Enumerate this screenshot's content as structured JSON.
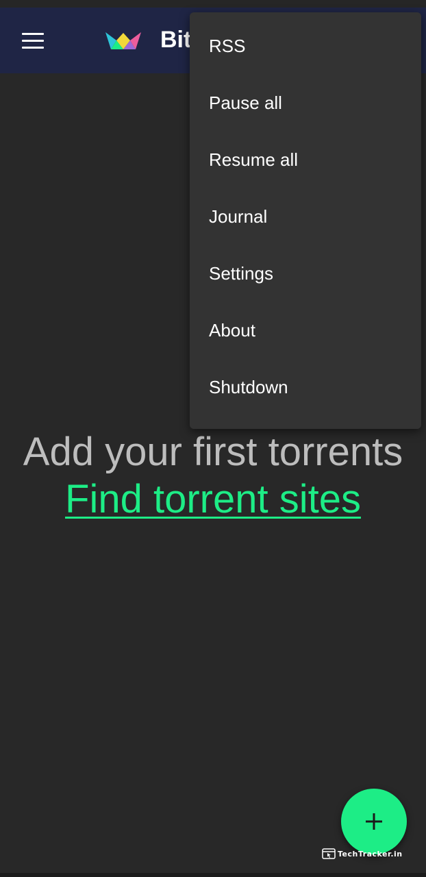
{
  "colors": {
    "background": "#282828",
    "app_bar": "#1f2545",
    "menu_background": "#333333",
    "accent": "#1ded86",
    "muted_text": "#bdbdbd",
    "text": "#ffffff"
  },
  "app_bar": {
    "menu_icon": "hamburger-menu-icon",
    "logo_icon": "crown-logo-icon",
    "title": "Bit"
  },
  "empty_state": {
    "title": "Add your first torrents",
    "link": "Find torrent sites"
  },
  "overflow_menu": {
    "items": [
      "RSS",
      "Pause all",
      "Resume all",
      "Journal",
      "Settings",
      "About",
      "Shutdown"
    ]
  },
  "fab": {
    "icon": "plus-icon"
  },
  "watermark": {
    "text": "TechTracker.in",
    "icon": "browser-window-icon"
  }
}
